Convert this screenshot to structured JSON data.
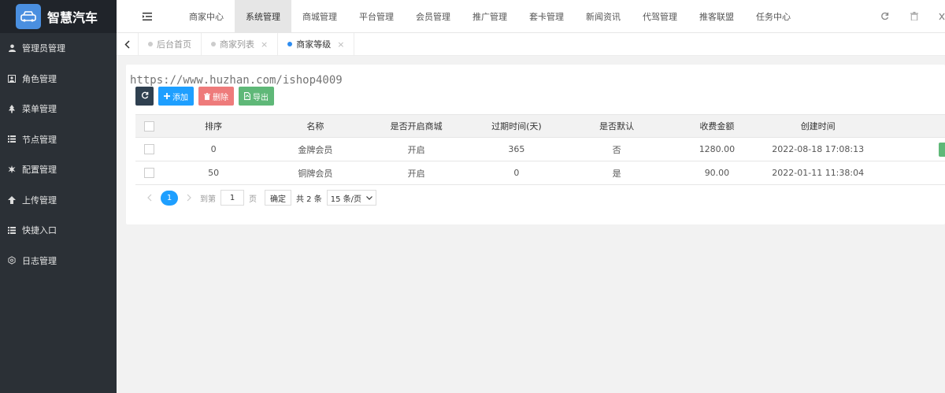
{
  "app": {
    "title": "智慧汽车"
  },
  "sidebar": {
    "items": [
      {
        "label": "管理员管理",
        "icon": "user-icon"
      },
      {
        "label": "角色管理",
        "icon": "role-icon"
      },
      {
        "label": "菜单管理",
        "icon": "tree-icon"
      },
      {
        "label": "节点管理",
        "icon": "list-icon"
      },
      {
        "label": "配置管理",
        "icon": "gear-icon"
      },
      {
        "label": "上传管理",
        "icon": "upload-icon"
      },
      {
        "label": "快捷入口",
        "icon": "list-icon"
      },
      {
        "label": "日志管理",
        "icon": "hex-icon"
      }
    ]
  },
  "topnav": {
    "items": [
      "商家中心",
      "系统管理",
      "商城管理",
      "平台管理",
      "会员管理",
      "推广管理",
      "套卡管理",
      "新闻资讯",
      "代驾管理",
      "推客联盟",
      "任务中心"
    ],
    "active_index": 1
  },
  "tabs": [
    {
      "label": "后台首页"
    },
    {
      "label": "商家列表"
    },
    {
      "label": "商家等级"
    }
  ],
  "watermark": "https://www.huzhan.com/ishop4009",
  "toolbar": {
    "add_label": "添加",
    "delete_label": "删除",
    "export_label": "导出"
  },
  "table": {
    "columns": [
      "排序",
      "名称",
      "是否开启商城",
      "过期时间(天)",
      "是否默认",
      "收费金额",
      "创建时间"
    ],
    "rows": [
      [
        "0",
        "金牌会员",
        "开启",
        "365",
        "否",
        "1280.00",
        "2022-08-18 17:08:13"
      ],
      [
        "50",
        "铜牌会员",
        "开启",
        "0",
        "是",
        "90.00",
        "2022-01-11 11:38:04"
      ]
    ]
  },
  "pager": {
    "current": "1",
    "goto_label": "到第",
    "goto_value": "1",
    "page_label": "页",
    "confirm_label": "确定",
    "total_label": "共 2 条",
    "page_size": "15 条/页"
  },
  "colors": {
    "sidebar_bg": "#2b3036",
    "primary": "#1e9fff",
    "danger": "#ee7b7b",
    "success": "#5fb878",
    "dark": "#2f4050"
  }
}
